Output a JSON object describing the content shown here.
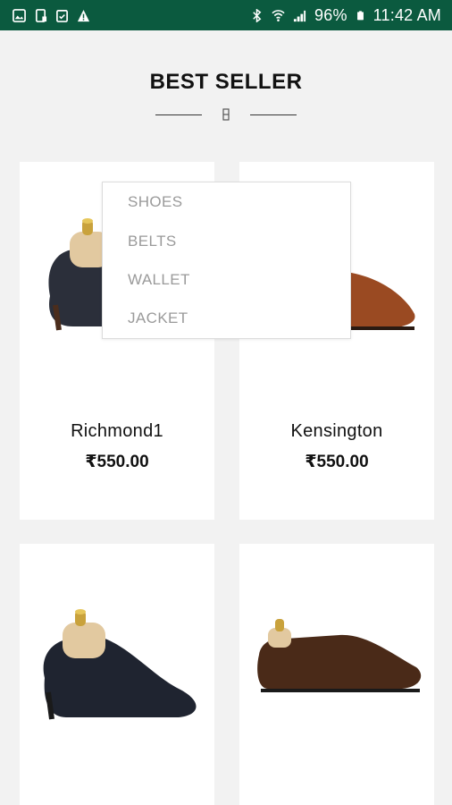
{
  "status_bar": {
    "battery": "96%",
    "time": "11:42 AM",
    "left_icons": [
      "image-icon",
      "phone-icon",
      "clipboard-icon",
      "warning-icon"
    ],
    "right_icons": [
      "bluetooth-icon",
      "wifi-icon",
      "signal-icon",
      "battery-icon"
    ]
  },
  "section": {
    "title": "BEST SELLER"
  },
  "dropdown": {
    "items": [
      "SHOES",
      "BELTS",
      "WALLET",
      "JACKET"
    ]
  },
  "products": [
    {
      "name": "Richmond1",
      "price": "₹550.00",
      "color": "#2b2f3a"
    },
    {
      "name": "Kensington",
      "price": "₹550.00",
      "color": "#9a4a22"
    },
    {
      "color": "#1f2430"
    },
    {
      "color": "#4a2a18"
    }
  ]
}
